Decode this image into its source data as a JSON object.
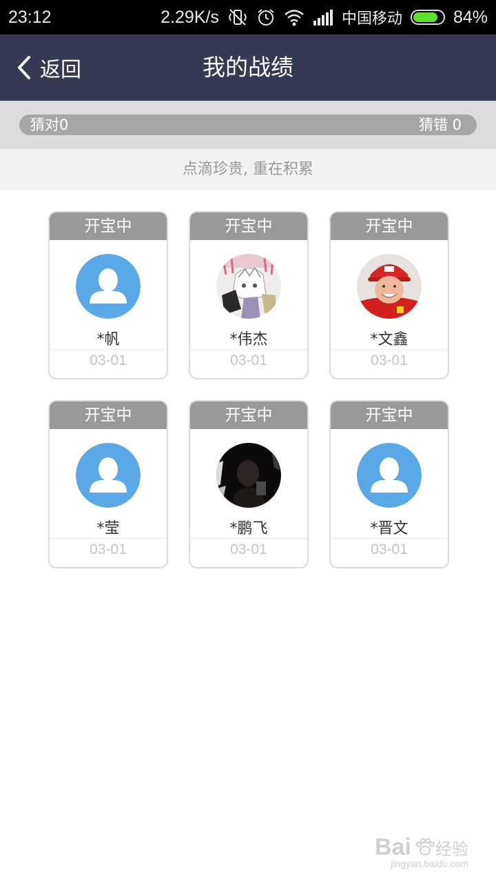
{
  "status_bar": {
    "time": "23:12",
    "net_speed": "2.29K/s",
    "carrier": "中国移动",
    "battery_percent": "84%",
    "battery_level": 0.84,
    "icons": [
      "vibrate-off-icon",
      "alarm-icon",
      "wifi-icon",
      "signal-icon",
      "battery-icon"
    ]
  },
  "nav": {
    "back_label": "返回",
    "title": "我的战绩"
  },
  "stats": {
    "correct": "猜对0",
    "wrong": "猜错 0"
  },
  "motto": "点滴珍贵, 重在积累",
  "records": [
    {
      "status": "开宝中",
      "name": "*帆",
      "date": "03-01",
      "avatar": "default-avatar"
    },
    {
      "status": "开宝中",
      "name": "*伟杰",
      "date": "03-01",
      "avatar": "anime-character-photo"
    },
    {
      "status": "开宝中",
      "name": "*文鑫",
      "date": "03-01",
      "avatar": "racing-driver-photo"
    },
    {
      "status": "开宝中",
      "name": "*莹",
      "date": "03-01",
      "avatar": "default-avatar"
    },
    {
      "status": "开宝中",
      "name": "*鹏飞",
      "date": "03-01",
      "avatar": "dark-portrait-photo"
    },
    {
      "status": "开宝中",
      "name": "*晋文",
      "date": "03-01",
      "avatar": "default-avatar"
    }
  ],
  "watermark": {
    "logo": "Bai",
    "logo_suffix": "经验",
    "url": "jingyan.baidu.com"
  },
  "colors": {
    "nav_bg": "#353954",
    "status_label_bg": "#999999",
    "default_avatar_bg": "#5aa9e6",
    "battery_fill": "#5fe02b"
  }
}
